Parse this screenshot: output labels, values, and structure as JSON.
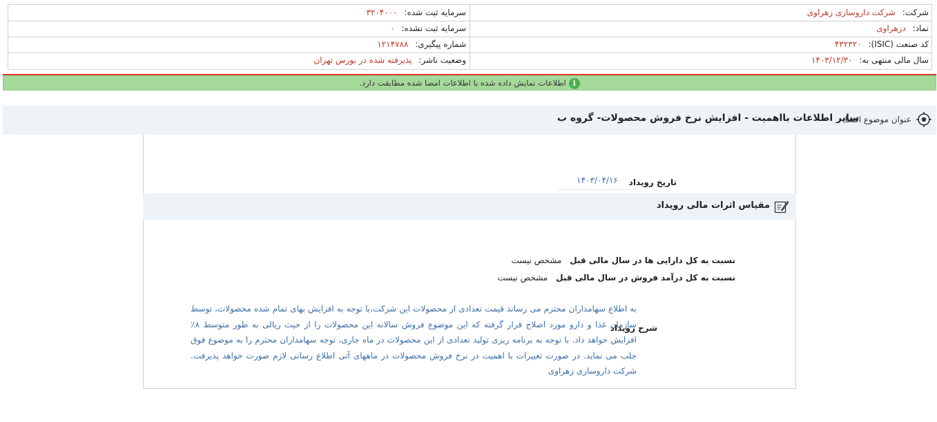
{
  "company_info": {
    "company_label": "شرکت:",
    "company_value": "شرکت داروسازی زهراوی",
    "symbol_label": "نماد:",
    "symbol_value": "دزهراوی",
    "isic_label": "کد صنعت (ISIC):",
    "isic_value": "۴۳۲۳۲۰",
    "fiscal_year_label": "سال مالی منتهی به:",
    "fiscal_year_value": "۱۴۰۳/۱۲/۳۰",
    "registered_capital_label": "سرمایه ثبت شده:",
    "registered_capital_value": "۳۲۰۴۰۰۰",
    "unregistered_capital_label": "سرمایه ثبت نشده:",
    "unregistered_capital_value": "۰",
    "tracking_label": "شماره پیگیری:",
    "tracking_value": "۱۲۱۴۷۸۸",
    "publisher_status_label": "وضعیت ناشر:",
    "publisher_status_value": "پذیرفته شده در بورس تهران"
  },
  "notice": {
    "icon": "info-icon",
    "text": "اطلاعات نمایش داده شده با اطلاعات امضا شده مطابقت دارد."
  },
  "title_bar": {
    "icon": "target-icon",
    "label": "عنوان موضوع افشا:",
    "title": "سایر اطلاعات بااهمیت - افزایش نرخ فروش محصولات- گروه ب"
  },
  "event": {
    "date_label": "تاریخ رویداد",
    "date_value": "۱۴۰۳/۰۴/۱۶"
  },
  "financial_effects": {
    "icon": "edit-note-icon",
    "heading": "مقیاس اثرات مالی رویداد",
    "metrics": [
      {
        "label": "نسبت به کل دارایی ها در سال مالی قبل",
        "value": "مشخص نیست"
      },
      {
        "label": "نسبت به کل درآمد فروش در سال مالی قبل",
        "value": "مشخص نیست"
      }
    ]
  },
  "description": {
    "label": "شرح رویداد",
    "text": "به اطلاع سهامداران محترم می رساند قیمت تعدادی از محصولات این شرکت،با توجه به افزایش بهای تمام شده محصولات، توسط سازمان غذا و دارو مورد اصلاح قرار گرفته که این موضوع فروش سالانه این محصولات را از حیث ریالی به طور متوسط ۸٪ افزایش خواهد داد. با توجه به برنامه ریزی تولید تعدادی از این محصولات در ماه جاری، توجه سهامداران محترم را به موضوع فوق جلب می نماید. در صورت تغییرات با اهمیت در نرخ فروش محصولات در ماههای آتی اطلاع رسانی لازم صورت خواهد پذیرفت. شرکت داروسازی زهراوی"
  },
  "colors": {
    "value_red": "#c0392b",
    "link_blue": "#3b6fa8",
    "notice_green": "#a5d99a",
    "header_bg": "#eef3f8"
  }
}
